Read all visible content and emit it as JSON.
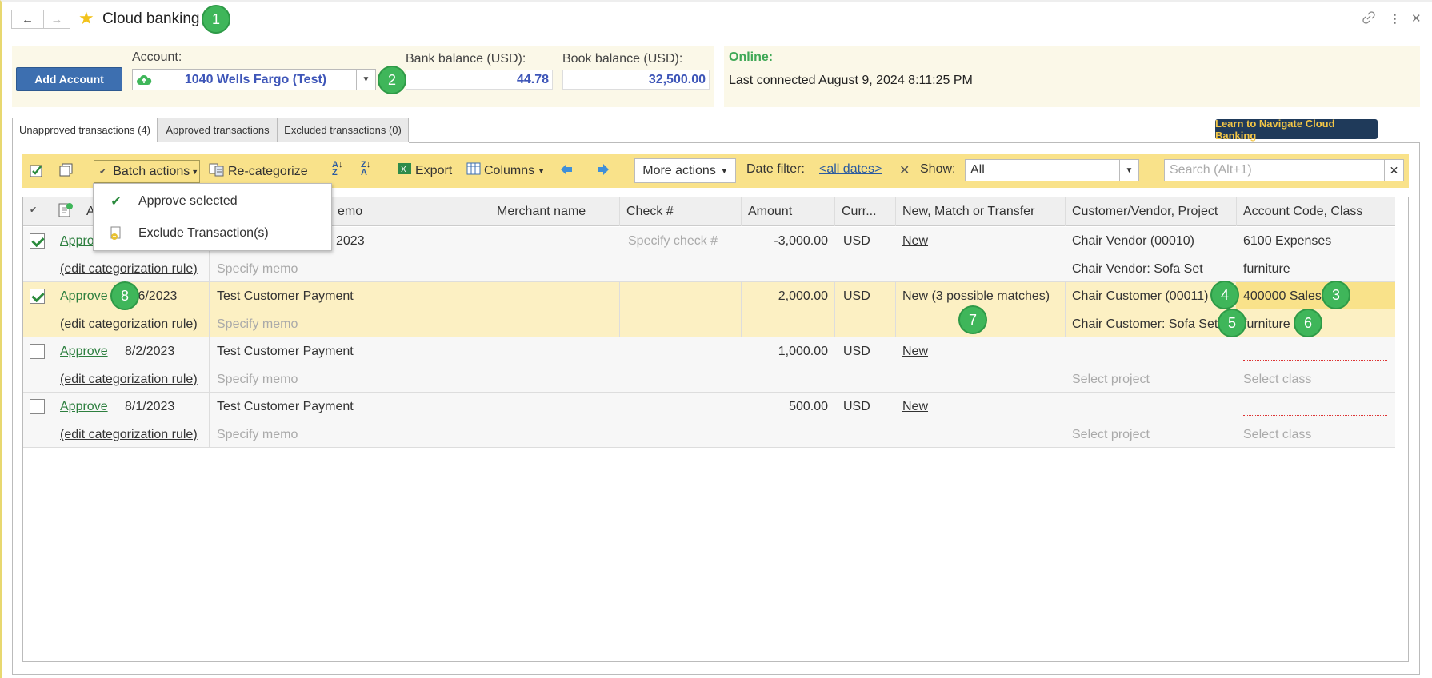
{
  "title": "Cloud banking",
  "badges": [
    "1",
    "2",
    "3",
    "4",
    "5",
    "6",
    "7",
    "8"
  ],
  "header": {
    "add_account": "Add Account",
    "account_label": "Account:",
    "account_value": "1040 Wells Fargo (Test)",
    "bank_balance_label": "Bank balance (USD):",
    "bank_balance": "44.78",
    "book_balance_label": "Book balance (USD):",
    "book_balance": "32,500.00",
    "online_label": "Online:",
    "last_connected": "Last connected August 9, 2024 8:11:25 PM"
  },
  "tabs": [
    "Unapproved transactions (4)",
    "Approved transactions",
    "Excluded transactions (0)"
  ],
  "learn": "Learn to Navigate Cloud Banking",
  "toolbar": {
    "batch_actions": "Batch actions",
    "recategorize": "Re-categorize",
    "export": "Export",
    "columns": "Columns",
    "more_actions": "More actions",
    "date_filter_label": "Date filter:",
    "date_filter_value": "<all dates>",
    "show_label": "Show:",
    "show_value": "All",
    "search_placeholder": "Search (Alt+1)"
  },
  "dropdown": [
    "Approve selected",
    "Exclude Transaction(s)"
  ],
  "columns": [
    "A",
    "emo",
    "Merchant name",
    "Check #",
    "Amount",
    "Curr...",
    "New, Match or Transfer",
    "Customer/Vendor, Project",
    "Account Code, Class"
  ],
  "rows": [
    {
      "approve": "Approve",
      "date": "2023",
      "desc": "",
      "check": "Specify check #",
      "amount": "-3,000.00",
      "currency": "USD",
      "match": "New",
      "cust": "Chair Vendor (00010)",
      "account": "6100 Expenses",
      "edit": "(edit categorization rule)",
      "memo": "Specify memo",
      "project": "Chair Vendor: Sofa Set",
      "class": "furniture",
      "checked": true
    },
    {
      "approve": "Approve",
      "date": "/6/2023",
      "desc": "Test Customer Payment",
      "check": "",
      "amount": "2,000.00",
      "currency": "USD",
      "match": "New (3 possible matches)",
      "cust": "Chair Customer (00011)",
      "account": "400000 Sales",
      "edit": "(edit categorization rule)",
      "memo": "Specify memo",
      "project": "Chair Customer: Sofa Set",
      "class": "furniture",
      "checked": true
    },
    {
      "approve": "Approve",
      "date": "8/2/2023",
      "desc": "Test Customer Payment",
      "check": "",
      "amount": "1,000.00",
      "currency": "USD",
      "match": "New",
      "cust": "",
      "account": "",
      "edit": "(edit categorization rule)",
      "memo": "Specify memo",
      "project": "Select project",
      "class": "Select class",
      "checked": false
    },
    {
      "approve": "Approve",
      "date": "8/1/2023",
      "desc": "Test Customer Payment",
      "check": "",
      "amount": "500.00",
      "currency": "USD",
      "match": "New",
      "cust": "",
      "account": "",
      "edit": "(edit categorization rule)",
      "memo": "Specify memo",
      "project": "Select project",
      "class": "Select class",
      "checked": false
    }
  ],
  "icons": {
    "back": "←",
    "forward": "→",
    "star": "★",
    "link": "🔗",
    "more": "⋮",
    "close": "✕"
  }
}
